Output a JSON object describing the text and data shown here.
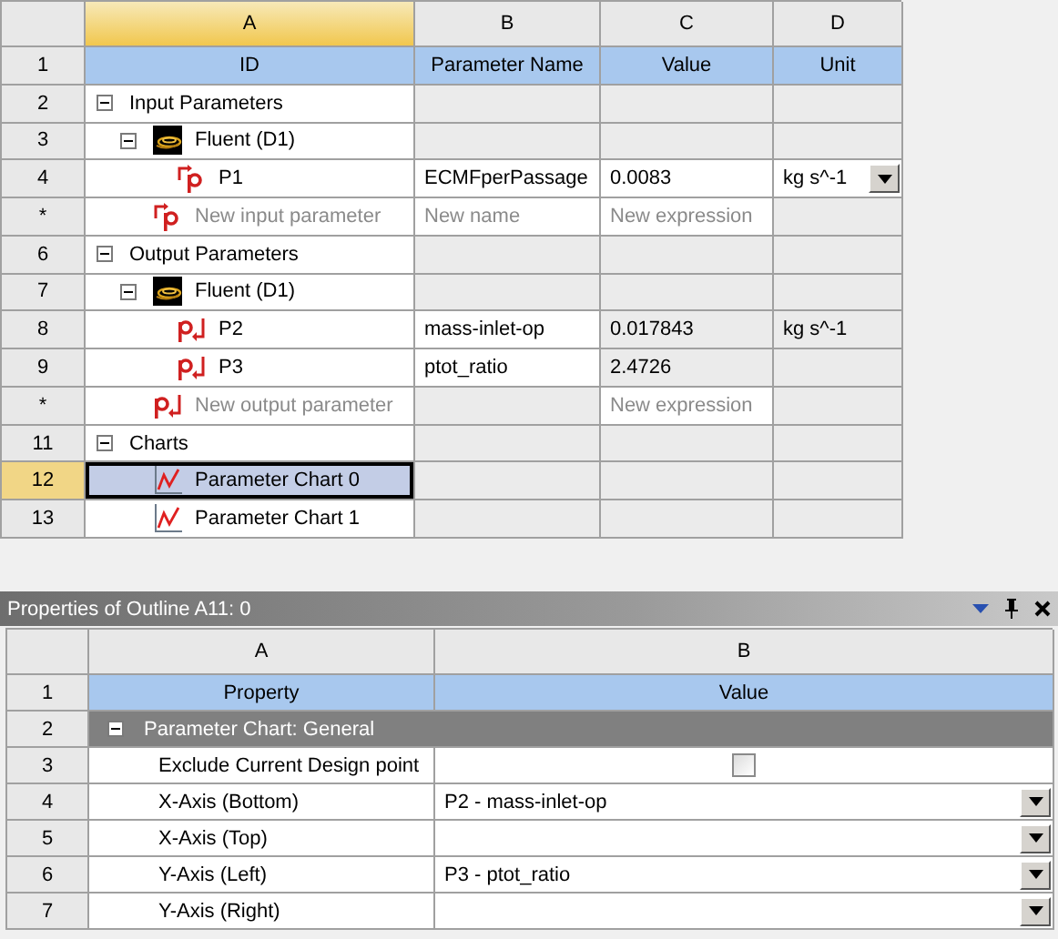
{
  "outline": {
    "columns": [
      {
        "label": "A",
        "selected": true
      },
      {
        "label": "B",
        "selected": false
      },
      {
        "label": "C",
        "selected": false
      },
      {
        "label": "D",
        "selected": false
      }
    ],
    "header_row": {
      "number": "1",
      "cells": [
        "ID",
        "Parameter Name",
        "Value",
        "Unit"
      ]
    },
    "rows": [
      {
        "number": "2",
        "kind": "group",
        "label": "Input Parameters",
        "expanded": true,
        "selected": false,
        "cells": [
          {
            "editable": false
          },
          {
            "editable": false
          },
          {
            "editable": false
          }
        ],
        "children": [
          {
            "number": "3",
            "kind": "system",
            "label": "Fluent (D1)",
            "expanded": true,
            "selected": false,
            "cells": [
              {
                "editable": false
              },
              {
                "editable": false
              },
              {
                "editable": false
              }
            ],
            "children": [
              {
                "number": "4",
                "kind": "input",
                "label": "P1",
                "selected": false,
                "cells": [
                  {
                    "text": "ECMFperPassage",
                    "editable": true
                  },
                  {
                    "text": "0.0083",
                    "editable": true
                  },
                  {
                    "text": "kg s^-1",
                    "editable": true,
                    "dropdown": true
                  }
                ]
              }
            ]
          },
          {
            "number": "*",
            "kind": "new-input",
            "placeholder": "New input parameter",
            "selected": false,
            "cells": [
              {
                "placeholder": "New name",
                "editable": true
              },
              {
                "placeholder": "New expression",
                "editable": true
              },
              {
                "editable": false
              }
            ]
          }
        ]
      },
      {
        "number": "6",
        "kind": "group",
        "label": "Output Parameters",
        "expanded": true,
        "selected": false,
        "cells": [
          {
            "editable": false
          },
          {
            "editable": false
          },
          {
            "editable": false
          }
        ],
        "children": [
          {
            "number": "7",
            "kind": "system",
            "label": "Fluent (D1)",
            "expanded": true,
            "selected": false,
            "cells": [
              {
                "editable": false
              },
              {
                "editable": false
              },
              {
                "editable": false
              }
            ],
            "children": [
              {
                "number": "8",
                "kind": "output",
                "label": "P2",
                "selected": false,
                "cells": [
                  {
                    "text": "mass-inlet-op",
                    "editable": true
                  },
                  {
                    "text": "0.017843",
                    "editable": false
                  },
                  {
                    "text": "kg s^-1",
                    "editable": false
                  }
                ]
              },
              {
                "number": "9",
                "kind": "output",
                "label": "P3",
                "selected": false,
                "cells": [
                  {
                    "text": "ptot_ratio",
                    "editable": true
                  },
                  {
                    "text": "2.4726",
                    "editable": false
                  },
                  {
                    "editable": false
                  }
                ]
              }
            ]
          },
          {
            "number": "*",
            "kind": "new-output",
            "placeholder": "New output parameter",
            "selected": false,
            "cells": [
              {
                "editable": false
              },
              {
                "placeholder": "New expression",
                "editable": true
              },
              {
                "editable": false
              }
            ]
          }
        ]
      },
      {
        "number": "11",
        "kind": "group",
        "label": "Charts",
        "expanded": true,
        "selected": false,
        "cells": [
          {
            "editable": false
          },
          {
            "editable": false
          },
          {
            "editable": false
          }
        ],
        "children": [
          {
            "number": "12",
            "kind": "chart",
            "label": "Parameter Chart 0",
            "selected": true,
            "cells": [
              {
                "editable": false
              },
              {
                "editable": false
              },
              {
                "editable": false
              }
            ]
          },
          {
            "number": "13",
            "kind": "chart",
            "label": "Parameter Chart 1",
            "selected": false,
            "cells": [
              {
                "editable": false
              },
              {
                "editable": false
              },
              {
                "editable": false
              }
            ]
          }
        ]
      }
    ]
  },
  "properties": {
    "title": "Properties of Outline A11: 0",
    "columns": [
      {
        "label": "A"
      },
      {
        "label": "B"
      }
    ],
    "header_row": {
      "number": "1",
      "cells": [
        "Property",
        "Value"
      ]
    },
    "rows": [
      {
        "number": "2",
        "kind": "group",
        "label": "Parameter Chart: General",
        "expanded": true,
        "children": [
          {
            "number": "3",
            "kind": "checkbox",
            "label": "Exclude Current Design point",
            "checked": false
          },
          {
            "number": "4",
            "kind": "dropdown",
            "label": "X-Axis (Bottom)",
            "value": "P2 - mass-inlet-op"
          },
          {
            "number": "5",
            "kind": "dropdown",
            "label": "X-Axis (Top)"
          },
          {
            "number": "6",
            "kind": "dropdown",
            "label": "Y-Axis (Left)",
            "value": "P3 - ptot_ratio"
          },
          {
            "number": "7",
            "kind": "dropdown",
            "label": "Y-Axis (Right)"
          }
        ]
      }
    ]
  }
}
